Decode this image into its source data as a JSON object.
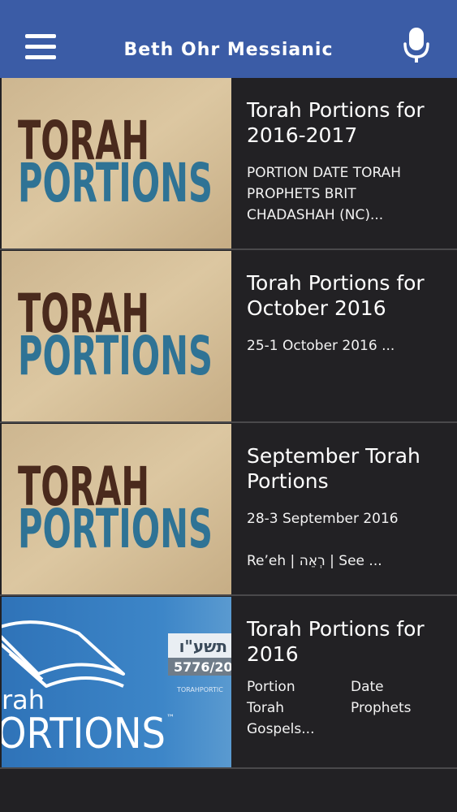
{
  "header": {
    "title": "Beth Ohr Messianic",
    "menu_icon": "hamburger-menu-icon",
    "mic_icon": "microphone-icon",
    "background": "#3b5ca6"
  },
  "thumbnail": {
    "line1": "TORAH",
    "line2": "PORTIONS",
    "line1_color": "#4a2a1d",
    "line2_color": "#2f7395"
  },
  "thumbnail_alt": {
    "hebrew": "תשע\"ו",
    "year": "5776/20",
    "site": "TORAHPORTIC",
    "left_text": "rah",
    "bottom_text": "ORTIONS",
    "tm": "™"
  },
  "items": [
    {
      "title": "Torah Portions for 2016-2017",
      "excerpt": "PORTION DATE TORAH PROPHETS BRIT CHADASHAH (NC)..."
    },
    {
      "title": "Torah Portions for October 2016",
      "excerpt": "25-1 October 2016 ..."
    },
    {
      "title": "September Torah Portions",
      "excerpt": "28-3 September 2016",
      "extra": "Re’eh | רְאֵה | See ..."
    },
    {
      "title": "Torah Portions for 2016",
      "excerpt_cells": [
        "Portion",
        "Date",
        "Torah",
        "Prophets",
        "Gospels...",
        ""
      ]
    }
  ]
}
